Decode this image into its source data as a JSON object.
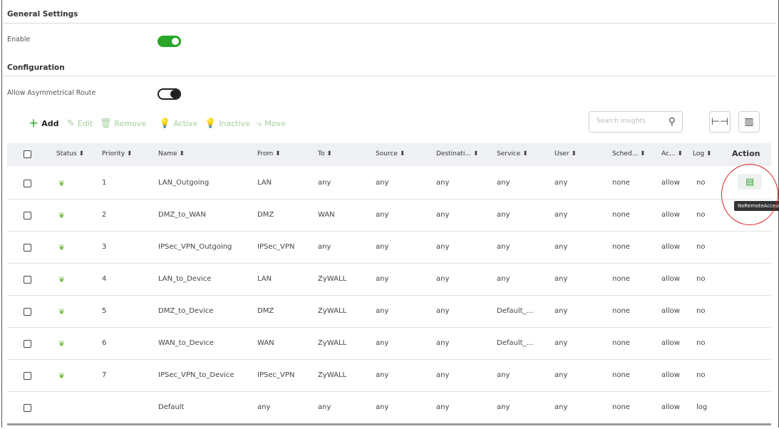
{
  "general": {
    "title": "General Settings",
    "enable_label": "Enable",
    "enable_state": true
  },
  "configuration": {
    "title": "Configuration",
    "asym_label": "Allow Asymmetrical Route",
    "asym_state": false
  },
  "toolbar": {
    "add": "Add",
    "edit": "Edit",
    "remove": "Remove",
    "active": "Active",
    "inactive": "Inactive",
    "move": "Move",
    "search_placeholder": "Search insights"
  },
  "columns": {
    "status": "Status ⬍",
    "priority": "Priority ⬍",
    "name": "Name ⬍",
    "from": "From ⬍",
    "to": "To ⬍",
    "source": "Source ⬍",
    "destination": "Destinati... ⬍",
    "service": "Service ⬍",
    "user": "User ⬍",
    "schedule": "Sched... ⬍",
    "access": "Ac... ⬍",
    "log": "Log ⬍",
    "action": "Action"
  },
  "rows": [
    {
      "status": true,
      "priority": "1",
      "name": "LAN_Outgoing",
      "from": "LAN",
      "to": "any",
      "source": "any",
      "destination": "any",
      "service": "any",
      "user": "any",
      "schedule": "none",
      "access": "allow",
      "log": "no"
    },
    {
      "status": true,
      "priority": "2",
      "name": "DMZ_to_WAN",
      "from": "DMZ",
      "to": "WAN",
      "source": "any",
      "destination": "any",
      "service": "any",
      "user": "any",
      "schedule": "none",
      "access": "allow",
      "log": "no"
    },
    {
      "status": true,
      "priority": "3",
      "name": "IPSec_VPN_Outgoing",
      "from": "IPSec_VPN",
      "to": "any",
      "source": "any",
      "destination": "any",
      "service": "any",
      "user": "any",
      "schedule": "none",
      "access": "allow",
      "log": "no"
    },
    {
      "status": true,
      "priority": "4",
      "name": "LAN_to_Device",
      "from": "LAN",
      "to": "ZyWALL",
      "source": "any",
      "destination": "any",
      "service": "any",
      "user": "any",
      "schedule": "none",
      "access": "allow",
      "log": "no"
    },
    {
      "status": true,
      "priority": "5",
      "name": "DMZ_to_Device",
      "from": "DMZ",
      "to": "ZyWALL",
      "source": "any",
      "destination": "any",
      "service": "Default_...",
      "user": "any",
      "schedule": "none",
      "access": "allow",
      "log": "no"
    },
    {
      "status": true,
      "priority": "6",
      "name": "WAN_to_Device",
      "from": "WAN",
      "to": "ZyWALL",
      "source": "any",
      "destination": "any",
      "service": "Default_...",
      "user": "any",
      "schedule": "none",
      "access": "allow",
      "log": "no"
    },
    {
      "status": true,
      "priority": "7",
      "name": "IPSec_VPN_to_Device",
      "from": "IPSec_VPN",
      "to": "ZyWALL",
      "source": "any",
      "destination": "any",
      "service": "any",
      "user": "any",
      "schedule": "none",
      "access": "allow",
      "log": "no"
    },
    {
      "status": false,
      "priority": "",
      "name": "Default",
      "from": "any",
      "to": "any",
      "source": "any",
      "destination": "any",
      "service": "any",
      "user": "any",
      "schedule": "none",
      "access": "allow",
      "log": "log"
    }
  ],
  "action_tooltip": "NoRemoteAccess",
  "colors": {
    "toggle_on": "#2aa52a",
    "status_bulb": "#6cbf3a",
    "highlight_circle": "#dd2222"
  }
}
